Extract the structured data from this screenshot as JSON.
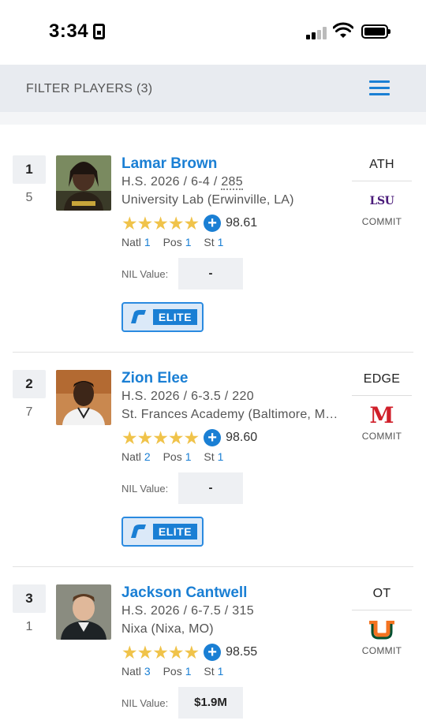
{
  "status": {
    "time": "3:34"
  },
  "filter": {
    "label": "FILTER PLAYERS (3)"
  },
  "players": [
    {
      "rank": "1",
      "sub_rank": "5",
      "name": "Lamar Brown",
      "meta_prefix": "H.S. 2026 / 6-4 / ",
      "weight": "285",
      "school": "University Lab (Erwinville, LA)",
      "stars": "★★★★★",
      "rating": "98.61",
      "natl_label": "Natl",
      "natl": "1",
      "pos_label": "Pos",
      "pos_rank": "1",
      "st_label": "St",
      "st": "1",
      "nil_label": "NIL Value:",
      "nil": "-",
      "badge": "ELITE",
      "position": "ATH",
      "college": "LSU",
      "status": "COMMIT",
      "college_color": "#4a1b7a"
    },
    {
      "rank": "2",
      "sub_rank": "7",
      "name": "Zion Elee",
      "meta_prefix": "H.S. 2026 / 6-3.5 / ",
      "weight": "220",
      "school": "St. Frances Academy (Baltimore, MD)",
      "stars": "★★★★★",
      "rating": "98.60",
      "natl_label": "Natl",
      "natl": "2",
      "pos_label": "Pos",
      "pos_rank": "1",
      "st_label": "St",
      "st": "1",
      "nil_label": "NIL Value:",
      "nil": "-",
      "badge": "ELITE",
      "position": "EDGE",
      "college": "M",
      "status": "COMMIT",
      "college_color": "#d01f2a"
    },
    {
      "rank": "3",
      "sub_rank": "1",
      "name": "Jackson Cantwell",
      "meta_prefix": "H.S. 2026 / 6-7.5 / ",
      "weight": "315",
      "school": "Nixa (Nixa, MO)",
      "stars": "★★★★★",
      "rating": "98.55",
      "natl_label": "Natl",
      "natl": "3",
      "pos_label": "Pos",
      "pos_rank": "1",
      "st_label": "St",
      "st": "1",
      "nil_label": "NIL Value:",
      "nil": "$1.9M",
      "position": "OT",
      "college": "U",
      "status": "COMMIT",
      "college_color": "#f47321"
    }
  ]
}
